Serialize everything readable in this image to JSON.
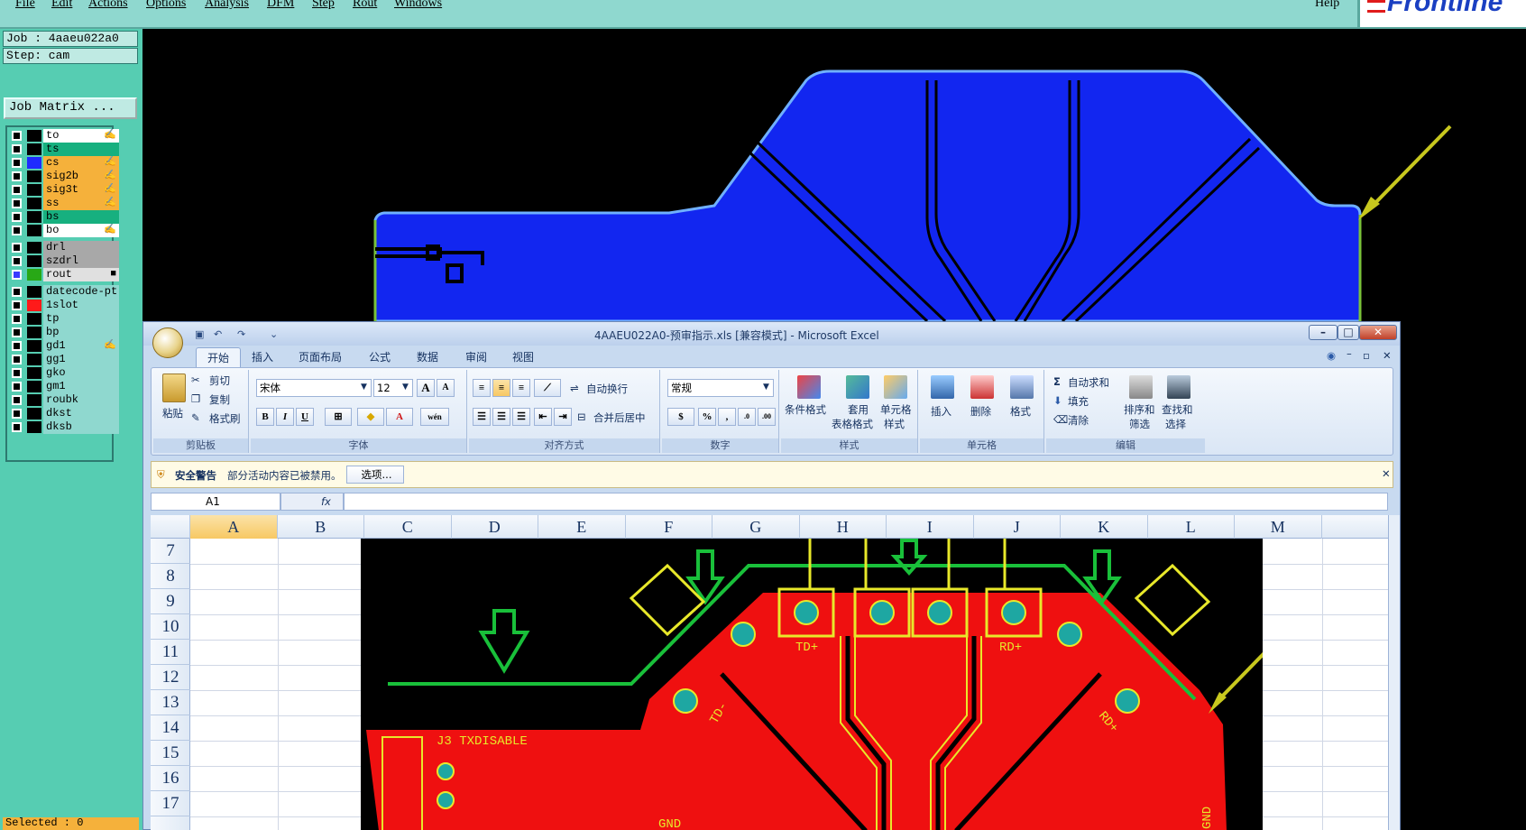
{
  "menu": [
    "File",
    "Edit",
    "Actions",
    "Options",
    "Analysis",
    "DFM",
    "Step",
    "Rout",
    "Windows"
  ],
  "help": "Help",
  "logo": "Frontline",
  "job": {
    "job_label": "Job : 4aaeu022a0",
    "step_label": "Step: cam",
    "matrix_button": "Job Matrix ..."
  },
  "layers": [
    {
      "name": "to",
      "bg": "#ffffff",
      "swatch": "#000000",
      "mark": "✍"
    },
    {
      "name": "ts",
      "bg": "#17b07f",
      "swatch": "#000000",
      "mark": ""
    },
    {
      "name": "cs",
      "bg": "#f5b13b",
      "swatch": "#1f2bff",
      "mark": "✍"
    },
    {
      "name": "sig2b",
      "bg": "#f5b13b",
      "swatch": "#000000",
      "mark": "✍"
    },
    {
      "name": "sig3t",
      "bg": "#f5b13b",
      "swatch": "#000000",
      "mark": "✍"
    },
    {
      "name": "ss",
      "bg": "#f5b13b",
      "swatch": "#000000",
      "mark": "✍"
    },
    {
      "name": "bs",
      "bg": "#17b07f",
      "swatch": "#000000",
      "mark": ""
    },
    {
      "name": "bo",
      "bg": "#ffffff",
      "swatch": "#000000",
      "mark": "✍"
    },
    {
      "name": "drl",
      "bg": "#a8a8a8",
      "swatch": "#000000",
      "mark": ""
    },
    {
      "name": "szdrl",
      "bg": "#a8a8a8",
      "swatch": "#000000",
      "mark": ""
    },
    {
      "name": "rout",
      "bg": "#e0e0e0",
      "swatch": "#28a816",
      "mark": "■"
    },
    {
      "name": "datecode-pt",
      "bg": "#8fd8cf",
      "swatch": "#000000",
      "mark": ""
    },
    {
      "name": "1slot",
      "bg": "#8fd8cf",
      "swatch": "#ff1a1a",
      "mark": ""
    },
    {
      "name": "tp",
      "bg": "#8fd8cf",
      "swatch": "#000000",
      "mark": ""
    },
    {
      "name": "bp",
      "bg": "#8fd8cf",
      "swatch": "#000000",
      "mark": ""
    },
    {
      "name": "gd1",
      "bg": "#8fd8cf",
      "swatch": "#000000",
      "mark": "✍"
    },
    {
      "name": "gg1",
      "bg": "#8fd8cf",
      "swatch": "#000000",
      "mark": ""
    },
    {
      "name": "gko",
      "bg": "#8fd8cf",
      "swatch": "#000000",
      "mark": ""
    },
    {
      "name": "gm1",
      "bg": "#8fd8cf",
      "swatch": "#000000",
      "mark": ""
    },
    {
      "name": "roubk",
      "bg": "#8fd8cf",
      "swatch": "#000000",
      "mark": ""
    },
    {
      "name": "dkst",
      "bg": "#8fd8cf",
      "swatch": "#000000",
      "mark": ""
    },
    {
      "name": "dksb",
      "bg": "#8fd8cf",
      "swatch": "#000000",
      "mark": ""
    }
  ],
  "status": "Selected : 0",
  "excel": {
    "title": "4AAEU022A0-预审指示.xls [兼容模式] - Microsoft Excel",
    "tabs": [
      "开始",
      "插入",
      "页面布局",
      "公式",
      "数据",
      "审阅",
      "视图"
    ],
    "clipboard": {
      "paste": "粘贴",
      "cut": "剪切",
      "copy": "复制",
      "format_painter": "格式刷",
      "label": "剪贴板"
    },
    "font": {
      "name": "宋体",
      "size": "12",
      "label": "字体"
    },
    "alignment": {
      "wrap": "自动换行",
      "merge": "合并后居中",
      "label": "对齐方式"
    },
    "number": {
      "format": "常规",
      "label": "数字"
    },
    "styles": {
      "conditional": "条件格式",
      "table_format_1": "套用",
      "table_format_2": "表格格式",
      "cell_style_1": "单元格",
      "cell_style_2": "样式",
      "label": "样式"
    },
    "cells": {
      "insert": "插入",
      "delete": "删除",
      "format": "格式",
      "label": "单元格"
    },
    "editing": {
      "autosum": "自动求和",
      "fill": "填充",
      "clear": "清除",
      "sort_1": "排序和",
      "sort_2": "筛选",
      "find_1": "查找和",
      "find_2": "选择",
      "label": "编辑"
    },
    "security": {
      "title": "安全警告",
      "message": "部分活动内容已被禁用。",
      "button": "选项..."
    },
    "namebox": "A1",
    "fx": "fx",
    "columns": [
      "A",
      "B",
      "C",
      "D",
      "E",
      "F",
      "G",
      "H",
      "I",
      "J",
      "K",
      "L",
      "M"
    ],
    "rows": [
      "7",
      "8",
      "9",
      "10",
      "11",
      "12",
      "13",
      "14",
      "15",
      "16",
      "17"
    ],
    "pcb_labels": {
      "td_plus": "TD+",
      "rd_plus": "RD+",
      "td_minus": "TD-",
      "rd_plus_2": "RD+",
      "j3": "J3 TXDISABLE",
      "gnd": "GND",
      "gnd2": "GND"
    }
  }
}
